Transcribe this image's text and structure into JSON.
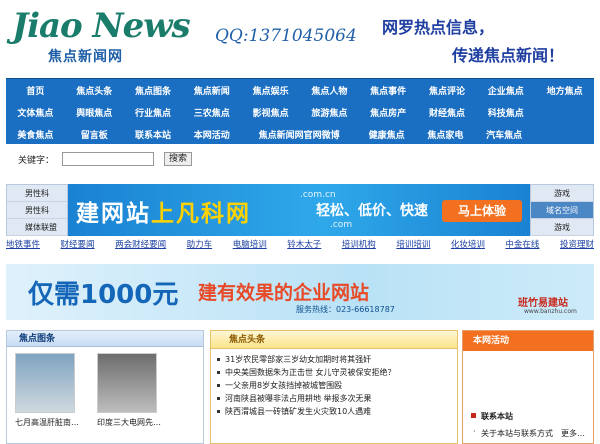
{
  "header": {
    "logo_en": "Jiao News",
    "logo_cn": "焦点新闻网",
    "qq": "QQ:1371045064",
    "slogan_line1": "网罗热点信息，",
    "slogan_line2": "传递焦点新闻！"
  },
  "nav": {
    "row1": [
      "首页",
      "焦点头条",
      "焦点图条",
      "焦点新闻",
      "焦点娱乐",
      "焦点人物",
      "焦点事件",
      "焦点评论",
      "企业焦点",
      "地方焦点"
    ],
    "row2": [
      "文体焦点",
      "舆眼焦点",
      "行业焦点",
      "三农焦点",
      "影视焦点",
      "旅游焦点",
      "焦点房产",
      "财经焦点",
      "科技焦点"
    ],
    "row3": [
      "美食焦点",
      "留言板",
      "联系本站",
      "本网活动",
      "焦点新闻网官网微博",
      "健康焦点",
      "焦点家电",
      "汽车焦点"
    ]
  },
  "search": {
    "label": "关键字：",
    "value": "",
    "button": "搜索"
  },
  "ad_left": [
    "男性科",
    "男性科",
    "媒体联盟"
  ],
  "ad_main": {
    "big_white": "建网站",
    "big_yellow": "上凡科网",
    "slogan": "轻松、低价、快速",
    "cta": "马上体验",
    "domain1": ".com.cn",
    "domain2": ".com"
  },
  "ad_right": [
    "游戏",
    "域名空间",
    "游戏"
  ],
  "link_row": [
    "地铁事件",
    "财经要闻",
    "两会财经要闻",
    "助力车",
    "电脑培训",
    "铃木太子",
    "培训机构",
    "培训培训",
    "化妆培训",
    "中金在线",
    "投资理财"
  ],
  "banner2": {
    "title_blue": "仅需1000元",
    "title_red": "建有效果的企业网站",
    "hotline": "服务热线：023-66618787",
    "brand": "班竹易建站",
    "brand_url": "www.banzhu.com"
  },
  "panel_left": {
    "title": "焦点图条",
    "items": [
      {
        "caption": "七月高温肝脏南…"
      },
      {
        "caption": "印度三大电网先…"
      }
    ]
  },
  "panel_mid": {
    "title": "焦点头条",
    "items": [
      "31岁农民零部家三岁幼女加期时将其强奸",
      "中央美国数据朱为正击世 女儿守灵被保安拒绝？",
      "一父亲用8岁女孩挡掉被城管围殴",
      "河南陕县被曝非法占用耕地 举报多次无果",
      "陕西渭城县一砖镇矿发生火灾致10人遇难"
    ]
  },
  "panel_right": {
    "title": "本网活动",
    "section": "联系本站",
    "item": "关于本站与联系方式",
    "more": "更多…"
  }
}
